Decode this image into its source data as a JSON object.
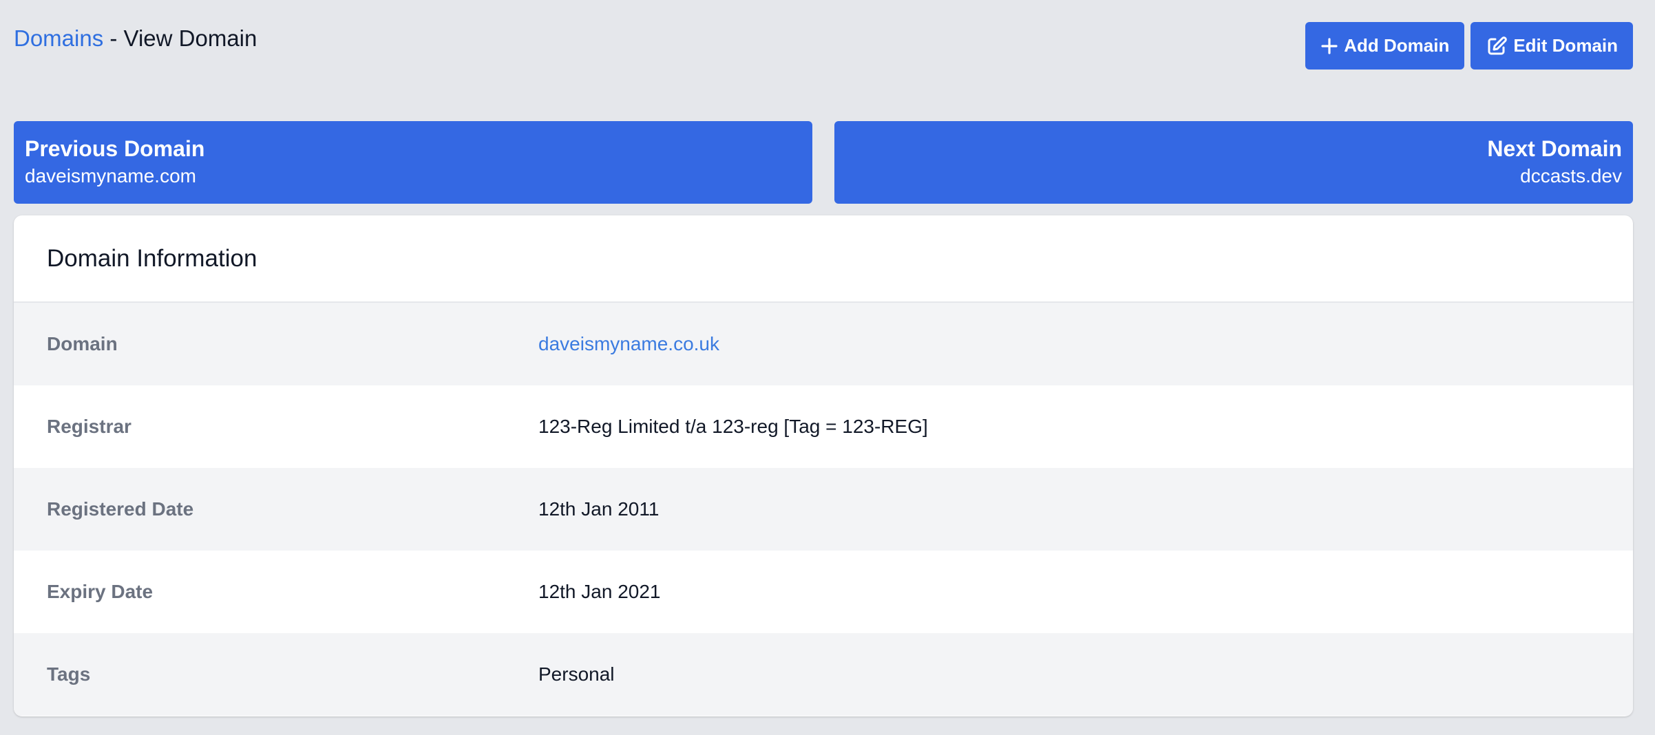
{
  "header": {
    "breadcrumb_link": "Domains",
    "breadcrumb_rest": " - View Domain"
  },
  "actions": {
    "add_label": "Add Domain",
    "edit_label": "Edit Domain"
  },
  "navigation": {
    "previous_label": "Previous Domain",
    "previous_domain": "daveismyname.com",
    "next_label": "Next Domain",
    "next_domain": "dccasts.dev"
  },
  "card": {
    "title": "Domain Information",
    "rows": [
      {
        "label": "Domain",
        "value": "daveismyname.co.uk"
      },
      {
        "label": "Registrar",
        "value": "123-Reg Limited t/a 123-reg [Tag = 123-REG]"
      },
      {
        "label": "Registered Date",
        "value": "12th Jan 2011"
      },
      {
        "label": "Expiry Date",
        "value": "12th Jan 2021"
      },
      {
        "label": "Tags",
        "value": "Personal"
      }
    ]
  },
  "colors": {
    "accent": "#3468e3",
    "link": "#2f6fe0",
    "background": "#e5e7eb"
  }
}
